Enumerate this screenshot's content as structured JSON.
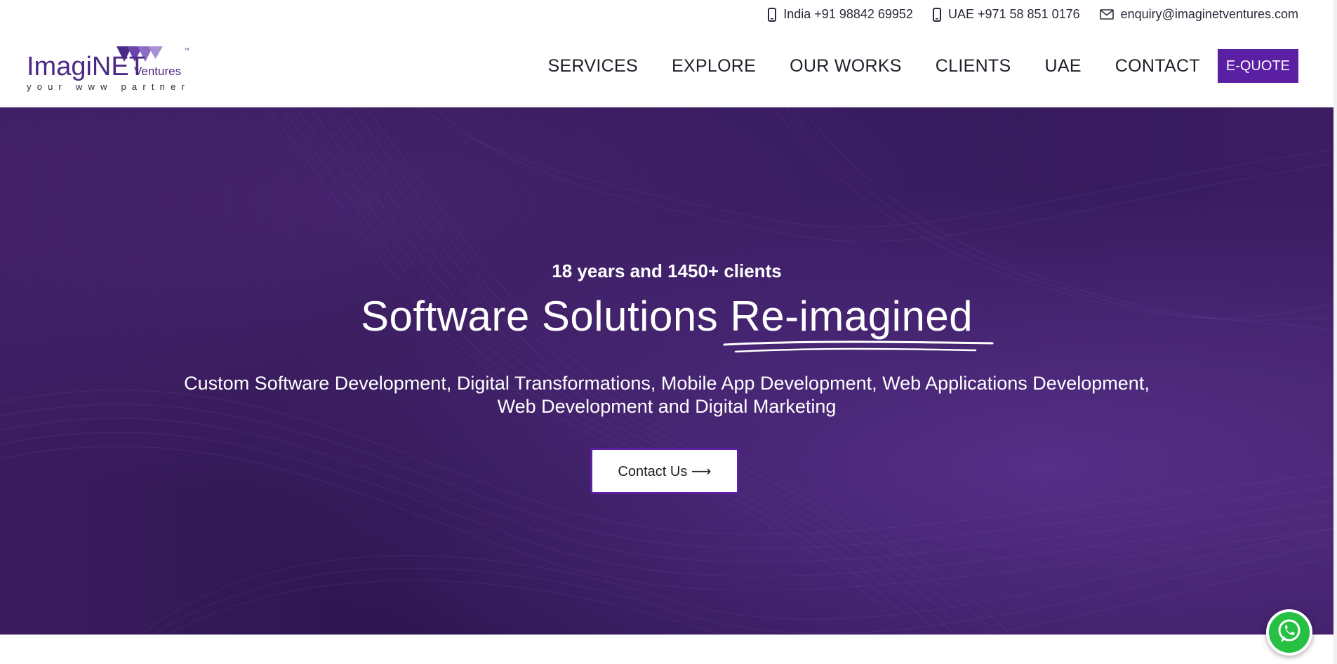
{
  "topbar": {
    "phone_india": "India +91 98842 69952",
    "phone_uae": "UAE +971 58 851 0176",
    "email": "enquiry@imaginetventures.com"
  },
  "logo": {
    "name_main": "ImagiNET",
    "name_sub": "Ventures",
    "tagline": "your www partner",
    "trademark": "™"
  },
  "nav": {
    "items": [
      "SERVICES",
      "EXPLORE",
      "OUR WORKS",
      "CLIENTS",
      "UAE",
      "CONTACT"
    ],
    "cta": "E-QUOTE"
  },
  "hero": {
    "kicker": "18 years and 1450+ clients",
    "headline_prefix": "Software Solutions",
    "headline_highlight": "Re-imagined",
    "subtitle_line1": "Custom Software Development, Digital Transformations, Mobile App Development, Web Applications Development,",
    "subtitle_line2": "Web Development and Digital Marketing",
    "cta_label": "Contact Us ⟶"
  },
  "colors": {
    "brand_purple": "#5a1fa3",
    "hero_bg": "#2e1650",
    "whatsapp_green": "#26c043"
  },
  "icons": [
    "phone-icon",
    "mail-icon",
    "whatsapp-icon"
  ]
}
